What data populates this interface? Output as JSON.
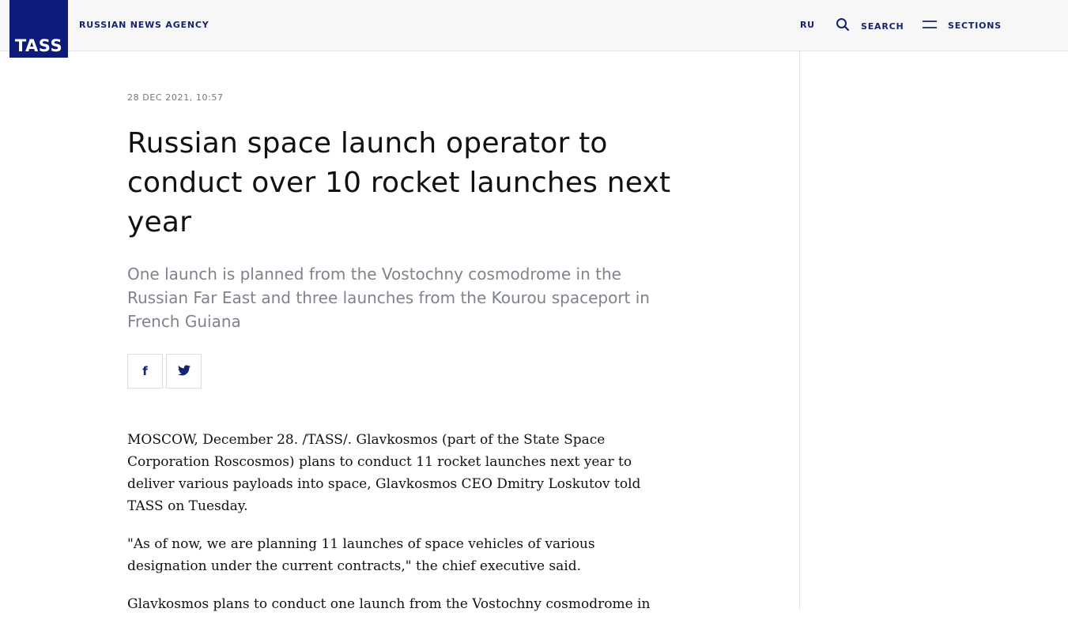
{
  "header": {
    "logo_text": "TASS",
    "agency_name": "RUSSIAN NEWS AGENCY",
    "lang_label": "RU",
    "search_label": "SEARCH",
    "sections_label": "SECTIONS"
  },
  "icons": {
    "search": "search-icon",
    "menu": "menu-icon",
    "facebook": "facebook-icon",
    "twitter": "twitter-icon"
  },
  "colors": {
    "brand": "#0f1b7a",
    "nav_text": "#17226e",
    "lead_text": "#7e838c",
    "date_text": "#75757d"
  },
  "article": {
    "date": "28 DEC 2021, 10:57",
    "title": "Russian space launch operator to conduct over 10 rocket launches next year",
    "lead": "One launch is planned from the Vostochny cosmodrome in the Russian Far East and three launches from the Kourou spaceport in French Guiana",
    "share": {
      "facebook_glyph": "f"
    },
    "paragraphs": [
      "MOSCOW, December 28. /TASS/. Glavkosmos (part of the State Space Corporation Roscosmos) plans to conduct 11 rocket launches next year to deliver various payloads into space, Glavkosmos CEO Dmitry Loskutov told TASS on Tuesday.",
      "\"As of now, we are planning 11 launches of space vehicles of various designation under the current contracts,\" the chief executive said.",
      "Glavkosmos plans to conduct one launch from the Vostochny cosmodrome in"
    ]
  }
}
